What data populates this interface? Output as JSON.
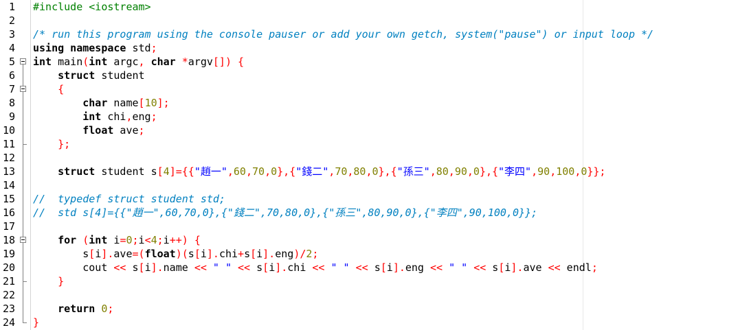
{
  "editor": {
    "line_numbers": [
      "1",
      "2",
      "3",
      "4",
      "5",
      "6",
      "7",
      "8",
      "9",
      "10",
      "11",
      "12",
      "13",
      "14",
      "15",
      "16",
      "17",
      "18",
      "19",
      "20",
      "21",
      "22",
      "23",
      "24"
    ],
    "lines": [
      [
        [
          "pp",
          "#include <iostream>"
        ]
      ],
      [],
      [
        [
          "cmt",
          "/* run this program using the console pauser or add your own getch, system(\"pause\") or input loop */"
        ]
      ],
      [
        [
          "kw",
          "using namespace"
        ],
        [
          "tx",
          " std"
        ],
        [
          "op",
          ";"
        ]
      ],
      [
        [
          "kw",
          "int"
        ],
        [
          "tx",
          " main"
        ],
        [
          "op",
          "("
        ],
        [
          "kw",
          "int"
        ],
        [
          "tx",
          " argc"
        ],
        [
          "op",
          ","
        ],
        [
          "tx",
          " "
        ],
        [
          "kw",
          "char"
        ],
        [
          "tx",
          " "
        ],
        [
          "op",
          "*"
        ],
        [
          "tx",
          "argv"
        ],
        [
          "op",
          "[])"
        ],
        [
          "tx",
          " "
        ],
        [
          "op",
          "{"
        ]
      ],
      [
        [
          "tx",
          "    "
        ],
        [
          "kw",
          "struct"
        ],
        [
          "tx",
          " student"
        ]
      ],
      [
        [
          "tx",
          "    "
        ],
        [
          "op",
          "{"
        ]
      ],
      [
        [
          "tx",
          "        "
        ],
        [
          "kw",
          "char"
        ],
        [
          "tx",
          " name"
        ],
        [
          "op",
          "["
        ],
        [
          "num",
          "10"
        ],
        [
          "op",
          "];"
        ]
      ],
      [
        [
          "tx",
          "        "
        ],
        [
          "kw",
          "int"
        ],
        [
          "tx",
          " chi"
        ],
        [
          "op",
          ","
        ],
        [
          "tx",
          "eng"
        ],
        [
          "op",
          ";"
        ]
      ],
      [
        [
          "tx",
          "        "
        ],
        [
          "kw",
          "float"
        ],
        [
          "tx",
          " ave"
        ],
        [
          "op",
          ";"
        ]
      ],
      [
        [
          "tx",
          "    "
        ],
        [
          "op",
          "};"
        ]
      ],
      [],
      [
        [
          "tx",
          "    "
        ],
        [
          "kw",
          "struct"
        ],
        [
          "tx",
          " student s"
        ],
        [
          "op",
          "["
        ],
        [
          "num",
          "4"
        ],
        [
          "op",
          "]={{"
        ],
        [
          "str",
          "\"趙一\""
        ],
        [
          "op",
          ","
        ],
        [
          "num",
          "60"
        ],
        [
          "op",
          ","
        ],
        [
          "num",
          "70"
        ],
        [
          "op",
          ","
        ],
        [
          "num",
          "0"
        ],
        [
          "op",
          "},{"
        ],
        [
          "str",
          "\"錢二\""
        ],
        [
          "op",
          ","
        ],
        [
          "num",
          "70"
        ],
        [
          "op",
          ","
        ],
        [
          "num",
          "80"
        ],
        [
          "op",
          ","
        ],
        [
          "num",
          "0"
        ],
        [
          "op",
          "},{"
        ],
        [
          "str",
          "\"孫三\""
        ],
        [
          "op",
          ","
        ],
        [
          "num",
          "80"
        ],
        [
          "op",
          ","
        ],
        [
          "num",
          "90"
        ],
        [
          "op",
          ","
        ],
        [
          "num",
          "0"
        ],
        [
          "op",
          "},{"
        ],
        [
          "str",
          "\"李四\""
        ],
        [
          "op",
          ","
        ],
        [
          "num",
          "90"
        ],
        [
          "op",
          ","
        ],
        [
          "num",
          "100"
        ],
        [
          "op",
          ","
        ],
        [
          "num",
          "0"
        ],
        [
          "op",
          "}};"
        ]
      ],
      [],
      [
        [
          "cmt",
          "//  typedef struct student std;"
        ]
      ],
      [
        [
          "cmt",
          "//  std s[4]={{\"趙一\",60,70,0},{\"錢二\",70,80,0},{\"孫三\",80,90,0},{\"李四\",90,100,0}};"
        ]
      ],
      [],
      [
        [
          "tx",
          "    "
        ],
        [
          "kw",
          "for"
        ],
        [
          "tx",
          " "
        ],
        [
          "op",
          "("
        ],
        [
          "kw",
          "int"
        ],
        [
          "tx",
          " i"
        ],
        [
          "op",
          "="
        ],
        [
          "num",
          "0"
        ],
        [
          "op",
          ";"
        ],
        [
          "tx",
          "i"
        ],
        [
          "op",
          "<"
        ],
        [
          "num",
          "4"
        ],
        [
          "op",
          ";"
        ],
        [
          "tx",
          "i"
        ],
        [
          "op",
          "++)"
        ],
        [
          "tx",
          " "
        ],
        [
          "op",
          "{"
        ]
      ],
      [
        [
          "tx",
          "        s"
        ],
        [
          "op",
          "["
        ],
        [
          "tx",
          "i"
        ],
        [
          "op",
          "]."
        ],
        [
          "tx",
          "ave"
        ],
        [
          "op",
          "=("
        ],
        [
          "kw",
          "float"
        ],
        [
          "op",
          ")("
        ],
        [
          "tx",
          "s"
        ],
        [
          "op",
          "["
        ],
        [
          "tx",
          "i"
        ],
        [
          "op",
          "]."
        ],
        [
          "tx",
          "chi"
        ],
        [
          "op",
          "+"
        ],
        [
          "tx",
          "s"
        ],
        [
          "op",
          "["
        ],
        [
          "tx",
          "i"
        ],
        [
          "op",
          "]."
        ],
        [
          "tx",
          "eng"
        ],
        [
          "op",
          ")/"
        ],
        [
          "num",
          "2"
        ],
        [
          "op",
          ";"
        ]
      ],
      [
        [
          "tx",
          "        cout "
        ],
        [
          "op",
          "<<"
        ],
        [
          "tx",
          " s"
        ],
        [
          "op",
          "["
        ],
        [
          "tx",
          "i"
        ],
        [
          "op",
          "]."
        ],
        [
          "tx",
          "name "
        ],
        [
          "op",
          "<<"
        ],
        [
          "tx",
          " "
        ],
        [
          "str",
          "\" \""
        ],
        [
          "tx",
          " "
        ],
        [
          "op",
          "<<"
        ],
        [
          "tx",
          " s"
        ],
        [
          "op",
          "["
        ],
        [
          "tx",
          "i"
        ],
        [
          "op",
          "]."
        ],
        [
          "tx",
          "chi "
        ],
        [
          "op",
          "<<"
        ],
        [
          "tx",
          " "
        ],
        [
          "str",
          "\" \""
        ],
        [
          "tx",
          " "
        ],
        [
          "op",
          "<<"
        ],
        [
          "tx",
          " s"
        ],
        [
          "op",
          "["
        ],
        [
          "tx",
          "i"
        ],
        [
          "op",
          "]."
        ],
        [
          "tx",
          "eng "
        ],
        [
          "op",
          "<<"
        ],
        [
          "tx",
          " "
        ],
        [
          "str",
          "\" \""
        ],
        [
          "tx",
          " "
        ],
        [
          "op",
          "<<"
        ],
        [
          "tx",
          " s"
        ],
        [
          "op",
          "["
        ],
        [
          "tx",
          "i"
        ],
        [
          "op",
          "]."
        ],
        [
          "tx",
          "ave "
        ],
        [
          "op",
          "<<"
        ],
        [
          "tx",
          " endl"
        ],
        [
          "op",
          ";"
        ]
      ],
      [
        [
          "tx",
          "    "
        ],
        [
          "op",
          "}"
        ]
      ],
      [],
      [
        [
          "tx",
          "    "
        ],
        [
          "kw",
          "return"
        ],
        [
          "tx",
          " "
        ],
        [
          "num",
          "0"
        ],
        [
          "op",
          ";"
        ]
      ],
      [
        [
          "op",
          "}"
        ]
      ]
    ]
  }
}
